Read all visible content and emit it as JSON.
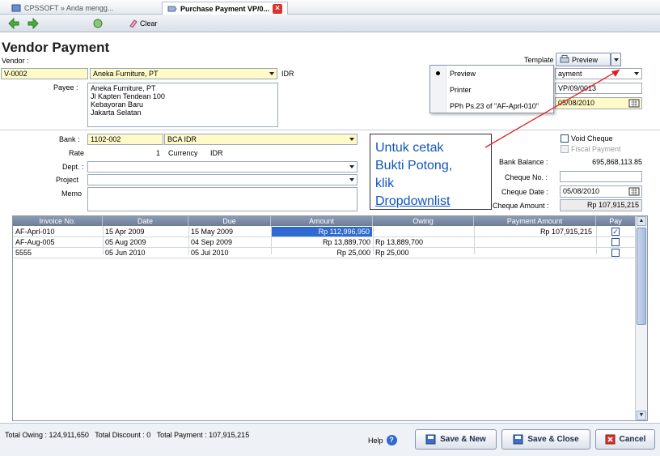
{
  "tabs": [
    {
      "label": "CPSSOFT » Anda mengg..."
    },
    {
      "label": "Purchase Payment VP/0..."
    }
  ],
  "toolbar": {
    "clear_label": "Clear"
  },
  "header": {
    "title": "Vendor Payment",
    "vendor_label": "Vendor :",
    "vendor_code": "V-0002",
    "vendor_name": "Aneka Furniture, PT",
    "currency": "IDR",
    "payee_label": "Payee :",
    "payee_lines": [
      "Aneka Furniture, PT",
      "Jl Kapten Tendean 100",
      "Kebayoran Baru",
      "Jakarta Selatan"
    ],
    "template_label": "Template",
    "preview_label": "Preview",
    "template_value_partial": "ayment",
    "payment_no_partial": "VP/09/0013",
    "payment_date": "05/08/2010"
  },
  "dropdown_menu": {
    "items": [
      "Preview",
      "Printer",
      "PPh Ps.23 of \"AF-Aprl-010\""
    ]
  },
  "bank": {
    "bank_label": "Bank :",
    "bank_code": "1102-002",
    "bank_name": "BCA IDR",
    "rate_label": "Rate",
    "rate_value": "1",
    "currency_label": "Currency",
    "currency_value": "IDR",
    "dept_label": "Dept. :",
    "project_label": "Project",
    "memo_label": "Memo"
  },
  "cheque": {
    "void_label": "Void Cheque",
    "fiscal_label": "Fiscal Payment",
    "bank_balance_label": "Bank Balance :",
    "bank_balance_value": "695,868,113.85",
    "cheque_no_label": "Cheque No. :",
    "cheque_date_label": "Cheque Date :",
    "cheque_date_value": "05/08/2010",
    "cheque_amount_label": "Cheque Amount :",
    "cheque_amount_value": "Rp 107,915,215"
  },
  "callout": {
    "lines": [
      "Untuk cetak",
      "Bukti Potong,",
      "klik",
      "Dropdownlist"
    ]
  },
  "grid": {
    "columns": [
      "Invoice No.",
      "Date",
      "Due",
      "Amount",
      "Owing",
      "Payment Amount",
      "Pay"
    ],
    "rows": [
      {
        "invoice": "AF-Aprl-010",
        "date": "15 Apr 2009",
        "due": "15 May 2009",
        "amount": "Rp 112,996,950",
        "owing": "",
        "payment": "Rp 107,915,215",
        "pay": true
      },
      {
        "invoice": "AF-Aug-005",
        "date": "05 Aug 2009",
        "due": "04 Sep 2009",
        "amount": "Rp 13,889,700",
        "owing": "Rp 13,889,700",
        "payment": "",
        "pay": false
      },
      {
        "invoice": "5555",
        "date": "05 Jun 2010",
        "due": "05 Jul 2010",
        "amount": "Rp 25,000",
        "owing": "Rp 25,000",
        "payment": "",
        "pay": false
      }
    ]
  },
  "footer": {
    "summary": "Total Owing : 124,911,650   Total Discount : 0   Total Payment : 107,915,215",
    "help_label": "Help",
    "save_new_label": "Save & New",
    "save_close_label": "Save & Close",
    "cancel_label": "Cancel"
  },
  "colors": {
    "accent": "#1155bb",
    "arrow": "#e02020",
    "header": "#7b8aa6",
    "field_yellow": "#fffbc8"
  }
}
